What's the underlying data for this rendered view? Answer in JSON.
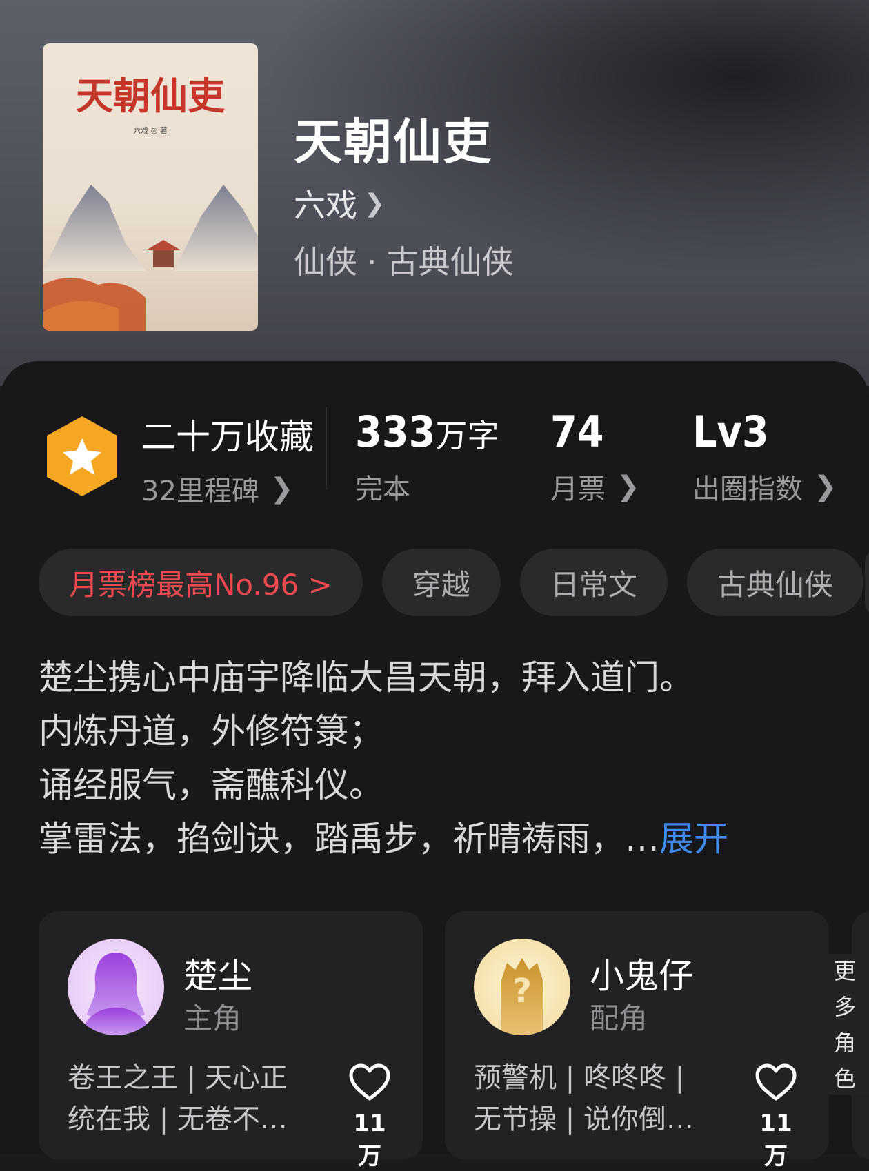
{
  "book": {
    "title": "天朝仙吏",
    "author": "六戏",
    "category": "仙侠",
    "subcategory": "古典仙侠",
    "genre_separator": "·",
    "cover_title": "天朝仙吏",
    "cover_author": "六戏 ◎ 著"
  },
  "stats": {
    "collection_title": "二十万收藏",
    "milestones": "32里程碑",
    "word_count_number": "333",
    "word_count_unit": "万字",
    "status": "完本",
    "monthly_votes_number": "74",
    "monthly_votes_label": "月票",
    "influence_level": "Lv3",
    "influence_label": "出圈指数"
  },
  "tags": [
    "月票榜最高No.96 >",
    "穿越",
    "日常文",
    "古典仙侠"
  ],
  "synopsis": {
    "lines": [
      "楚尘携心中庙宇降临大昌天朝，拜入道门。",
      "内炼丹道，外修符箓；",
      "诵经服气，斋醮科仪。",
      "掌雷法，掐剑诀，踏禹步，祈晴祷雨，…"
    ],
    "expand_label": "展开"
  },
  "characters": [
    {
      "name": "楚尘",
      "role": "主角",
      "tags_line1": "卷王之王 | 天心正",
      "tags_line2": "统在我 | 无卷不…",
      "likes": "11万"
    },
    {
      "name": "小鬼仔",
      "role": "配角",
      "tags_line1": "预警机 | 咚咚咚 |",
      "tags_line2": "无节操 | 说你倒…",
      "likes": "11万"
    }
  ],
  "more_characters": [
    "更",
    "多",
    "角",
    "色"
  ],
  "colors": {
    "accent_red": "#ec4a4f",
    "link_blue": "#3f8cf0",
    "badge_orange": "#f5a623"
  }
}
